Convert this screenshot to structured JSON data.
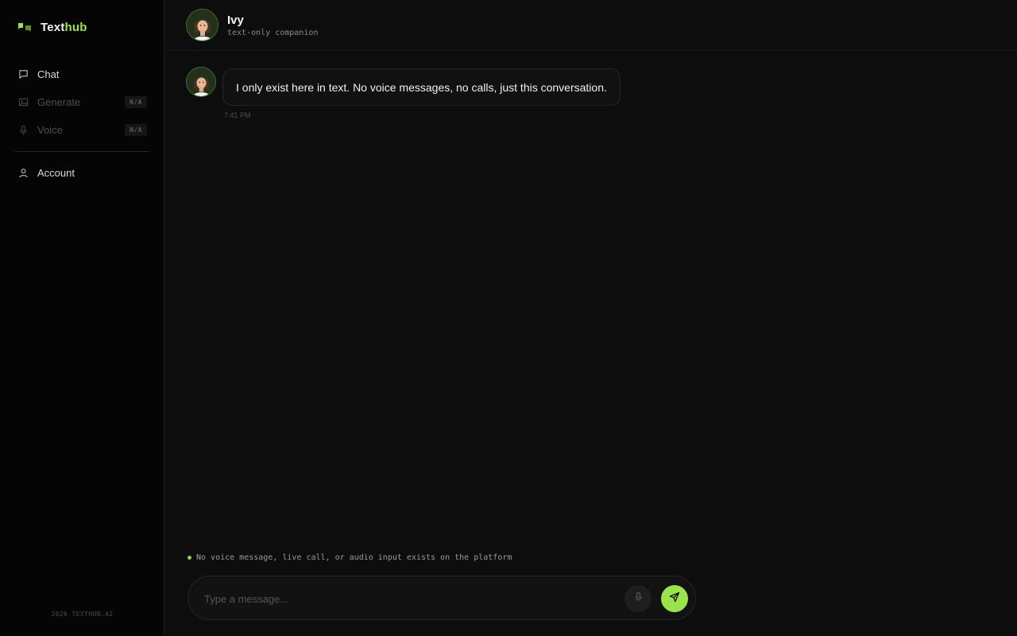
{
  "brand": {
    "name_main": "Text",
    "name_accent": "hub",
    "accent_color": "#9be34a",
    "logo_icon": "chat-bubbles-icon"
  },
  "sidebar": {
    "items": [
      {
        "label": "Chat",
        "icon": "chat-icon",
        "badge": ""
      },
      {
        "label": "Generate",
        "icon": "image-icon",
        "badge": "N/A"
      },
      {
        "label": "Voice",
        "icon": "mic-icon",
        "badge": "N/A"
      },
      {
        "label": "Account",
        "icon": "user-icon",
        "badge": ""
      }
    ],
    "footer": "2026 TEXTHUB.AI"
  },
  "header": {
    "name": "Ivy",
    "subtitle": "text-only companion",
    "avatar_icon": "character-avatar"
  },
  "messages": [
    {
      "sender": "Ivy",
      "text": "I only exist here in text. No voice messages, no calls, just this conversation.",
      "time": "7:41 PM"
    }
  ],
  "notice": {
    "text": "No voice message, live call, or audio input exists on the platform",
    "dot_color": "#8fd14a"
  },
  "composer": {
    "placeholder": "Type a message...",
    "mic_icon": "mic-icon",
    "send_icon": "send-icon"
  }
}
